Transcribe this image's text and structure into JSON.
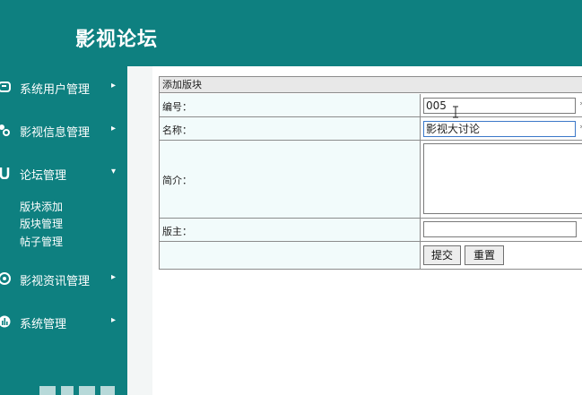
{
  "header": {
    "title": "影视论坛"
  },
  "sidebar": {
    "items": [
      {
        "label": "系统用户管理",
        "icon": "user-card-icon",
        "arrow": "▸"
      },
      {
        "label": "影视信息管理",
        "icon": "people-gear-icon",
        "arrow": "▸"
      },
      {
        "label": "论坛管理",
        "icon": "magnet-icon",
        "arrow": "▾"
      },
      {
        "label": "影视资讯管理",
        "icon": "target-icon",
        "arrow": "▸"
      },
      {
        "label": "系统管理",
        "icon": "bar-chart-icon",
        "arrow": "▸"
      }
    ],
    "forum_subitems": [
      "版块添加",
      "版块管理",
      "帖子管理"
    ]
  },
  "form": {
    "title": "添加版块",
    "fields": {
      "id": {
        "label": "编号：",
        "value": "005"
      },
      "name": {
        "label": "名称：",
        "value": "影视大讨论"
      },
      "intro": {
        "label": "简介：",
        "value": ""
      },
      "moderator": {
        "label": "版主：",
        "value": ""
      }
    },
    "submit_label": "提交",
    "reset_label": "重置"
  },
  "colors": {
    "brand": "#0e8080",
    "label_bg": "#f2fbfb"
  }
}
